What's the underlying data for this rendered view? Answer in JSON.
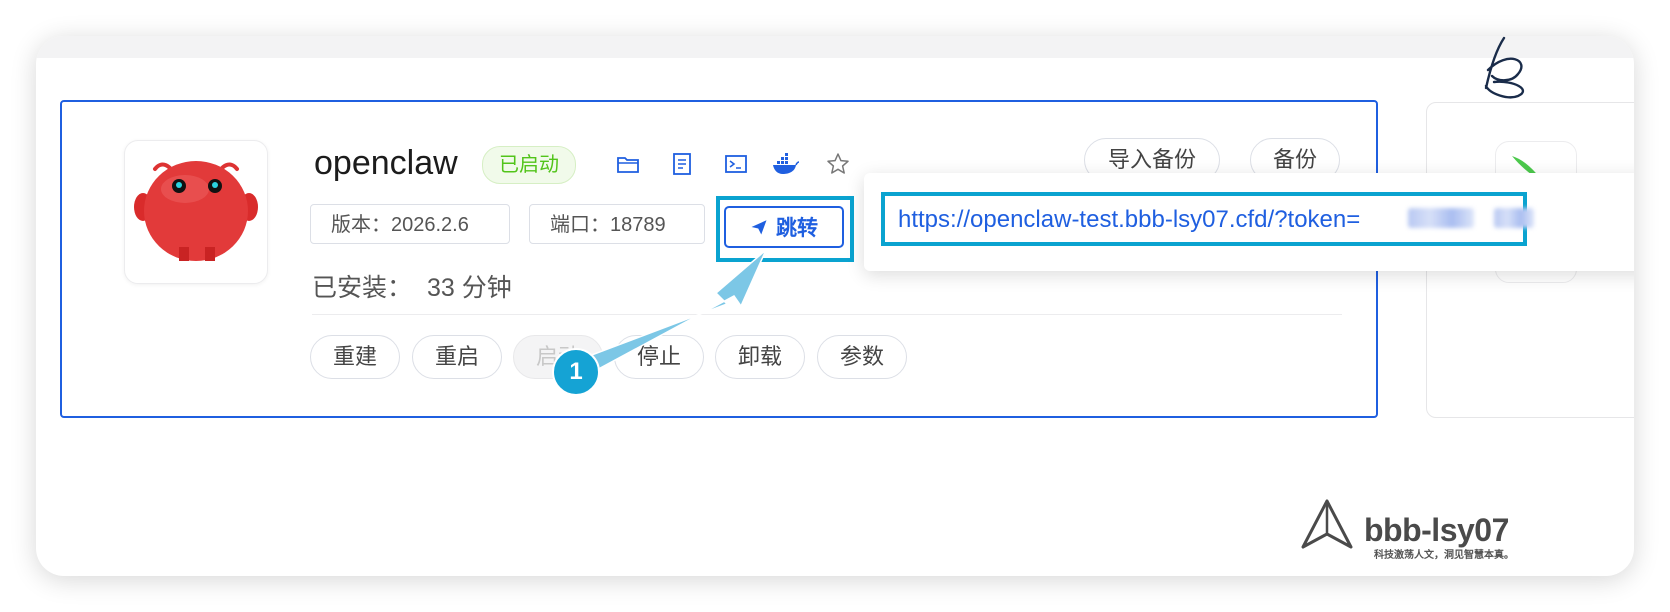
{
  "app": {
    "name": "openclaw",
    "status": "已启动",
    "version_label": "版本：2026.2.6",
    "port_label": "端口：18789",
    "jump_label": "跳转",
    "installed_label": "已安装：",
    "installed_value": "33 分钟",
    "url": "https://openclaw-test.bbb-lsy07.cfd/?token="
  },
  "header_icons": [
    "folder-icon",
    "document-icon",
    "terminal-icon",
    "docker-icon",
    "star-icon"
  ],
  "top_buttons": {
    "import_backup": "导入备份",
    "backup": "备份"
  },
  "actions": [
    {
      "label": "重建",
      "disabled": false
    },
    {
      "label": "重启",
      "disabled": false
    },
    {
      "label": "启动",
      "disabled": true
    },
    {
      "label": "停止",
      "disabled": false
    },
    {
      "label": "卸载",
      "disabled": false
    },
    {
      "label": "参数",
      "disabled": false
    }
  ],
  "annotation": {
    "number": "1"
  },
  "watermark": {
    "brand": "bbb-lsy07",
    "slogan": "科技激荡人文，洞见智慧本真。"
  },
  "colors": {
    "primary": "#1f5fe0",
    "highlight": "#0aa3d0",
    "success": "#52c41a",
    "arrow": "#7cc7e6"
  }
}
